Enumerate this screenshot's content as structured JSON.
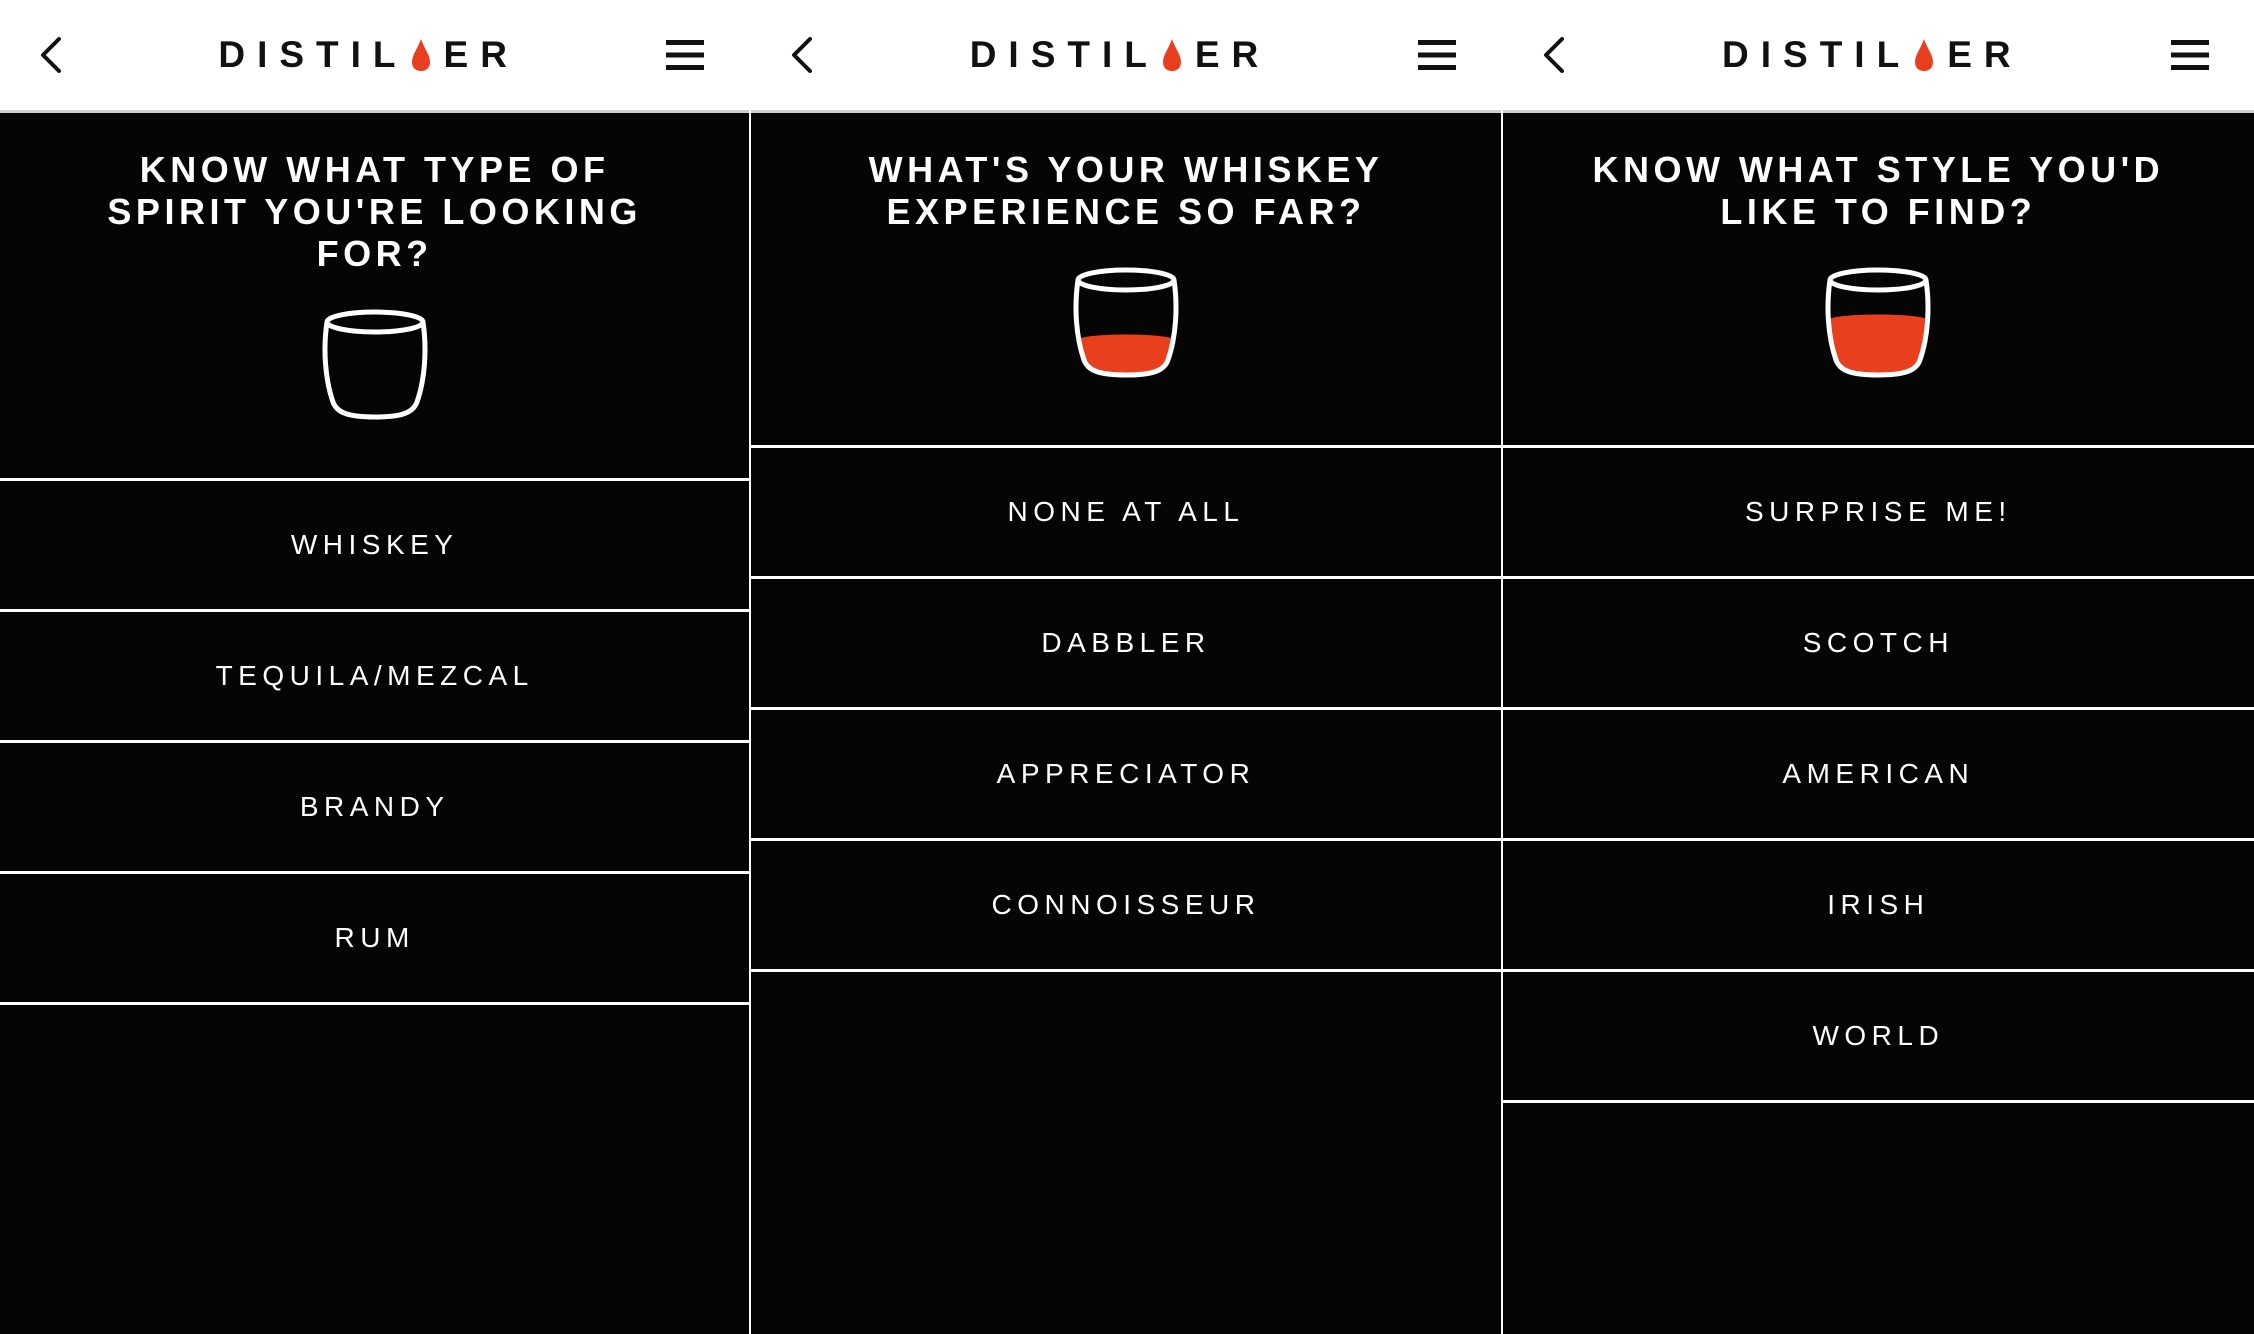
{
  "brand": {
    "logo_left": "DISTIL",
    "logo_right": "ER",
    "drop_color": "#E8401F"
  },
  "icons": {
    "back": "chevron-left-icon",
    "menu": "hamburger-menu-icon",
    "glass": "whiskey-glass-icon"
  },
  "colors": {
    "background": "#050505",
    "navbar": "#FFFFFF",
    "whiskey_fill": "#E8401F",
    "text": "#FFFFFF"
  },
  "screens": [
    {
      "question": "KNOW WHAT TYPE OF SPIRIT YOU'RE LOOKING FOR?",
      "glass_fill": 0,
      "options": [
        "WHISKEY",
        "TEQUILA/MEZCAL",
        "BRANDY",
        "RUM"
      ]
    },
    {
      "question": "WHAT'S YOUR WHISKEY EXPERIENCE SO FAR?",
      "glass_fill": 0.35,
      "options": [
        "NONE AT ALL",
        "DABBLER",
        "APPRECIATOR",
        "CONNOISSEUR"
      ]
    },
    {
      "question": "KNOW WHAT STYLE YOU'D LIKE TO FIND?",
      "glass_fill": 0.5,
      "options": [
        "SURPRISE ME!",
        "SCOTCH",
        "AMERICAN",
        "IRISH",
        "WORLD"
      ]
    }
  ]
}
